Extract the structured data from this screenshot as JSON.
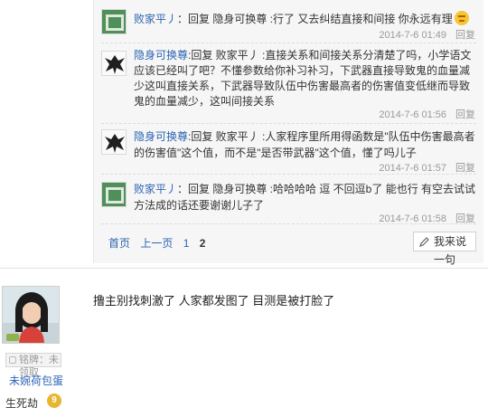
{
  "replies": [
    {
      "user": "败家平丿",
      "text": "：回复 隐身可换尊 :行了 又去纠结直接和间接 你永远有理",
      "time": "2014-7-6 01:49",
      "reply_label": "回复",
      "avatar_icon": "green-frame-avatar-icon"
    },
    {
      "user": "隐身可换尊",
      "text": ":回复 败家平丿 :直接关系和间接关系分清楚了吗，小学语文应该已经叫了吧？不懂参数给你补习补习，下武器直接导致鬼的血量减少这叫直接关系，下武器导致队伍中伤害最高者的伤害值变低继而导致鬼的血量减少，这叫间接关系",
      "time": "2014-7-6 01:56",
      "reply_label": "回复",
      "avatar_icon": "black-bird-avatar-icon"
    },
    {
      "user": "隐身可换尊",
      "text": ":回复 败家平丿 :人家程序里所用得函数是\"队伍中伤害最高者的伤害值\"这个值，而不是\"是否带武器\"这个值，懂了吗儿子",
      "time": "2014-7-6 01:57",
      "reply_label": "回复",
      "avatar_icon": "black-bird-avatar-icon"
    },
    {
      "user": "败家平丿",
      "text": "：回复 隐身可换尊 :哈哈哈哈 逗 不回逗b了 能也行 有空去试试 方法成的话还要谢谢儿子了",
      "time": "2014-7-6 01:58",
      "reply_label": "回复",
      "avatar_icon": "green-frame-avatar-icon"
    }
  ],
  "pager": {
    "first": "首页",
    "prev": "上一页",
    "page1": "1",
    "page2": "2"
  },
  "say_button": "我来说一句",
  "post": {
    "author_name": "未婉荷包蛋",
    "badge_text": "铭牌：未领取",
    "level_label": "生死劫",
    "level_value": "9",
    "text": "撸主别找刺激了 人家都发图了 目测是被打脸了"
  },
  "colors": {
    "link": "#2d64b3",
    "reply_bg": "#f6f6f6",
    "meta": "#999999"
  }
}
